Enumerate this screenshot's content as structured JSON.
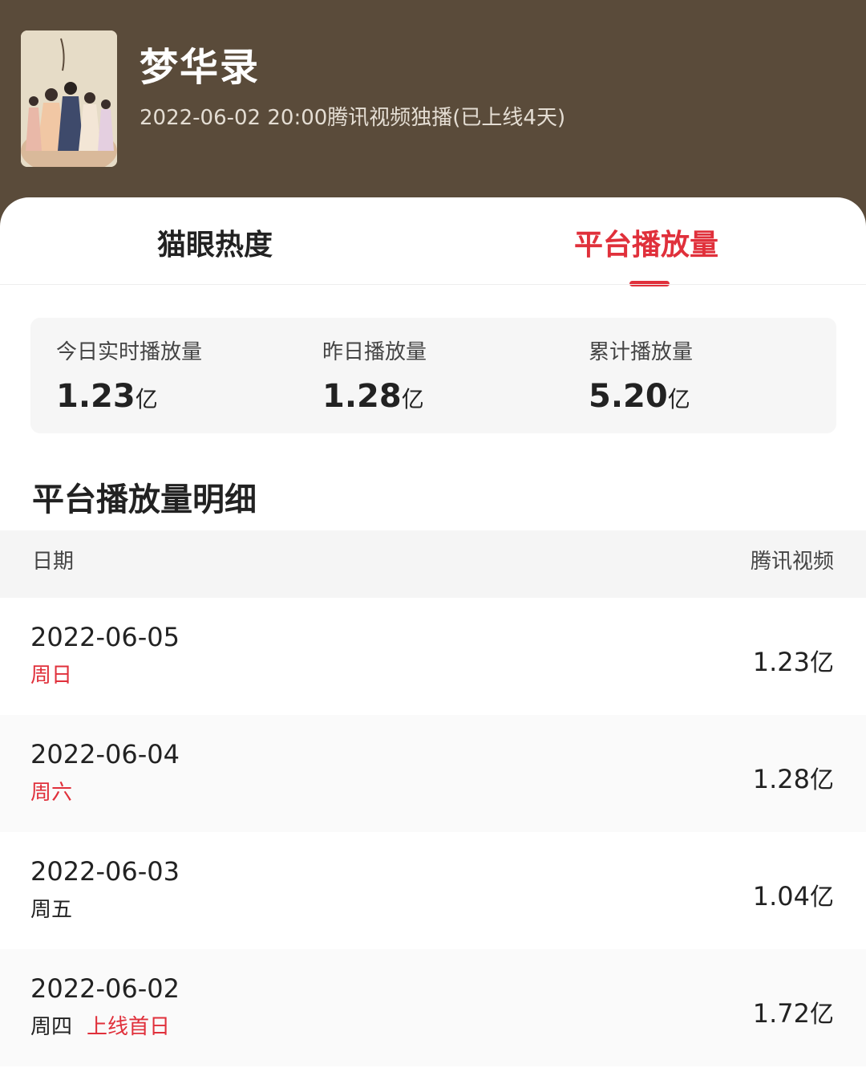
{
  "show": {
    "title": "梦华录",
    "release_info": "2022-06-02 20:00腾讯视频独播(已上线4天)"
  },
  "tabs": [
    {
      "label": "猫眼热度",
      "active": false
    },
    {
      "label": "平台播放量",
      "active": true
    }
  ],
  "summary": [
    {
      "label": "今日实时播放量",
      "value": "1.23",
      "unit": "亿"
    },
    {
      "label": "昨日播放量",
      "value": "1.28",
      "unit": "亿"
    },
    {
      "label": "累计播放量",
      "value": "5.20",
      "unit": "亿"
    }
  ],
  "detail": {
    "title": "平台播放量明细",
    "col_date": "日期",
    "col_platform": "腾讯视频",
    "rows": [
      {
        "date": "2022-06-05",
        "weekday": "周日",
        "tag": "",
        "value": "1.23",
        "unit": "亿"
      },
      {
        "date": "2022-06-04",
        "weekday": "周六",
        "tag": "",
        "value": "1.28",
        "unit": "亿"
      },
      {
        "date": "2022-06-03",
        "weekday": "周五",
        "tag": "",
        "value": "1.04",
        "unit": "亿"
      },
      {
        "date": "2022-06-02",
        "weekday": "周四",
        "tag": "上线首日",
        "value": "1.72",
        "unit": "亿"
      }
    ]
  },
  "colors": {
    "header_bg": "#5a4b3a",
    "accent": "#e0303b"
  }
}
